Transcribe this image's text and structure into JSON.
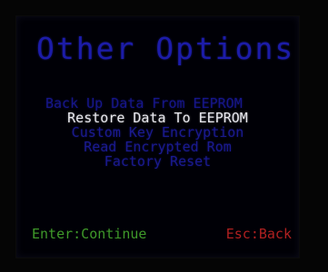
{
  "screen": {
    "title": "Other Options"
  },
  "menu": {
    "items": [
      {
        "label": "Back Up Data From EEPROM"
      },
      {
        "label": "Restore Data To EEPROM"
      },
      {
        "label": "Custom Key Encryption"
      },
      {
        "label": "Read Encrypted Rom"
      },
      {
        "label": "Factory Reset"
      }
    ],
    "selected_index": 1
  },
  "footer": {
    "enter_hint": "Enter:Continue",
    "esc_hint": "Esc:Back"
  },
  "colors": {
    "title": "#1c1ca8",
    "menu_item": "#1a1a8f",
    "menu_selected": "#e8e8ee",
    "enter_hint": "#3f9a2a",
    "esc_hint": "#b02020",
    "background": "#000006"
  }
}
